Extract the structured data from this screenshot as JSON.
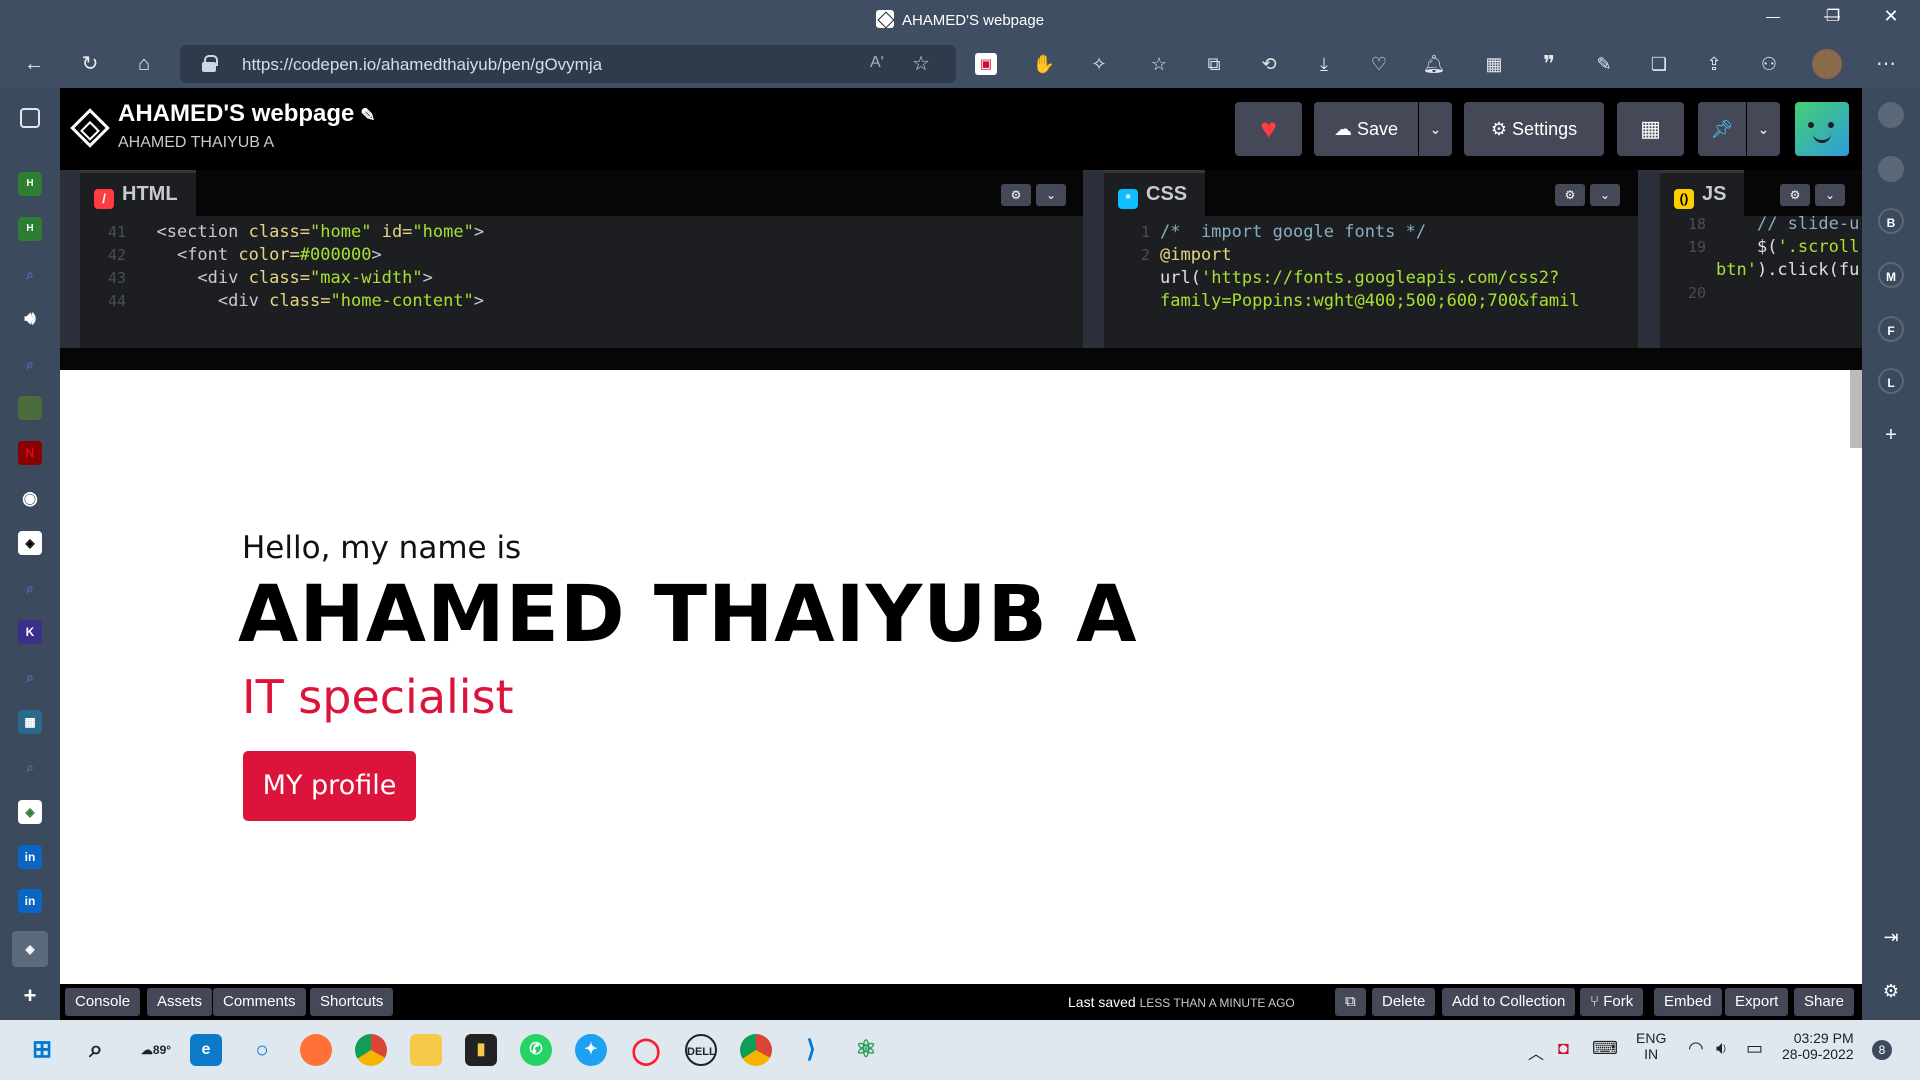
{
  "browser": {
    "window_title": "AHAMED'S webpage",
    "url_host": "https://codepen.io",
    "url_path": "/ahamedthaiyub/pen/gOvymja",
    "read_aloud_label": "Aʹ"
  },
  "codepen": {
    "pen_title": "AHAMED'S webpage",
    "author": "AHAMED THAIYUB A",
    "save_label": "Save",
    "settings_label": "Settings",
    "editors": {
      "html": {
        "label": "HTML",
        "lines": [
          {
            "n": "41",
            "indent": "  ",
            "tokens": [
              [
                "tag",
                "<section "
              ],
              [
                "attr",
                "class="
              ],
              [
                "str",
                "\"home\""
              ],
              [
                "tag",
                " "
              ],
              [
                "attr",
                "id="
              ],
              [
                "str",
                "\"home\""
              ],
              [
                "tag",
                ">"
              ]
            ]
          },
          {
            "n": "42",
            "indent": "    ",
            "tokens": [
              [
                "tag",
                "<font "
              ],
              [
                "attr",
                "color="
              ],
              [
                "str",
                "#000000"
              ],
              [
                "tag",
                ">"
              ]
            ]
          },
          {
            "n": "43",
            "indent": "      ",
            "tokens": [
              [
                "tag",
                "<div "
              ],
              [
                "attr",
                "class="
              ],
              [
                "str",
                "\"max-width\""
              ],
              [
                "tag",
                ">"
              ]
            ]
          },
          {
            "n": "44",
            "indent": "        ",
            "tokens": [
              [
                "tag",
                "<div "
              ],
              [
                "attr",
                "class="
              ],
              [
                "str",
                "\"home-content\""
              ],
              [
                "tag",
                ">"
              ]
            ]
          }
        ]
      },
      "css": {
        "label": "CSS",
        "lines": [
          {
            "n": "1",
            "indent": "",
            "tokens": [
              [
                "cmt",
                "/*  import google fonts */"
              ]
            ]
          },
          {
            "n": "2",
            "indent": "",
            "tokens": [
              [
                "kw",
                "@import"
              ]
            ]
          },
          {
            "n": "",
            "indent": "",
            "tokens": [
              [
                "plain",
                "url("
              ],
              [
                "str",
                "'https://fonts.googleapis.com/css2?"
              ]
            ]
          },
          {
            "n": "",
            "indent": "",
            "tokens": [
              [
                "str",
                "family=Poppins:wght@400;500;600;700&famil"
              ]
            ]
          }
        ]
      },
      "js": {
        "label": "JS",
        "lines": [
          {
            "n": "18",
            "indent": "    ",
            "tokens": [
              [
                "cmt",
                "// slide-u"
              ]
            ]
          },
          {
            "n": "19",
            "indent": "    ",
            "tokens": [
              [
                "plain",
                "$("
              ],
              [
                "str",
                "'.scroll"
              ]
            ]
          },
          {
            "n": "",
            "indent": "",
            "tokens": [
              [
                "str",
                "btn'"
              ],
              [
                "plain",
                ").click(fu"
              ]
            ]
          },
          {
            "n": "20",
            "indent": "",
            "tokens": []
          }
        ]
      }
    },
    "preview": {
      "greeting": "Hello, my name is",
      "name": "AHAMED THAIYUB A",
      "role": "IT specialist",
      "button": "MY profile",
      "accent_color": "#dc143c"
    },
    "footer": {
      "console": "Console",
      "assets": "Assets",
      "comments": "Comments",
      "shortcuts": "Shortcuts",
      "last_saved": "Last saved",
      "last_saved_when": "LESS THAN A MINUTE AGO",
      "delete": "Delete",
      "add_to_collection": "Add to Collection",
      "fork": "Fork",
      "embed": "Embed",
      "export": "Export",
      "share": "Share"
    }
  },
  "right_sidebar": {
    "letters": [
      "B",
      "M",
      "F",
      "L"
    ]
  },
  "taskbar": {
    "weather": "89°",
    "language": "ENG",
    "region": "IN",
    "time": "03:29 PM",
    "date": "28-09-2022",
    "notifications": "8"
  }
}
